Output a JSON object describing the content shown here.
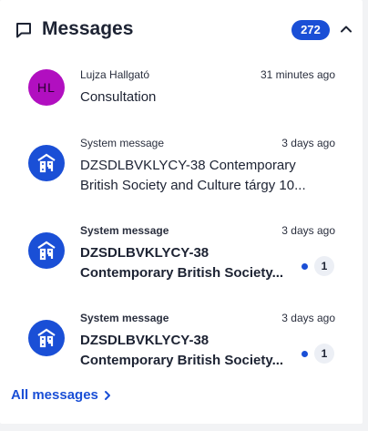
{
  "header": {
    "title": "Messages",
    "count": "272",
    "icon": "chat-bubble-icon",
    "collapse_icon": "chevron-up-icon"
  },
  "messages": [
    {
      "avatar_type": "initials",
      "avatar_initials": "HL",
      "avatar_color": "#b10fc0",
      "sender": "Lujza Hallgató",
      "time": "31 minutes ago",
      "subject_line1": "Consultation",
      "unread": false
    },
    {
      "avatar_type": "system",
      "avatar_icon": "system-logo-icon",
      "sender": "System message",
      "time": "3 days ago",
      "subject_line1": "DZSDLBVKLYCY-38 Contemporary",
      "subject_line2": "British Society and Culture tárgy 10...",
      "unread": false
    },
    {
      "avatar_type": "system",
      "avatar_icon": "system-logo-icon",
      "sender": "System message",
      "time": "3 days ago",
      "subject_line1": "DZSDLBVKLYCY-38",
      "subject_line2": "Contemporary British Society...",
      "unread": true,
      "unread_count": "1"
    },
    {
      "avatar_type": "system",
      "avatar_icon": "system-logo-icon",
      "sender": "System message",
      "time": "3 days ago",
      "subject_line1": "DZSDLBVKLYCY-38",
      "subject_line2": "Contemporary British Society...",
      "unread": true,
      "unread_count": "1"
    }
  ],
  "footer": {
    "all_messages_label": "All messages"
  },
  "colors": {
    "accent": "#1a4fd6",
    "avatar_user": "#b10fc0",
    "background": "#ffffff"
  }
}
